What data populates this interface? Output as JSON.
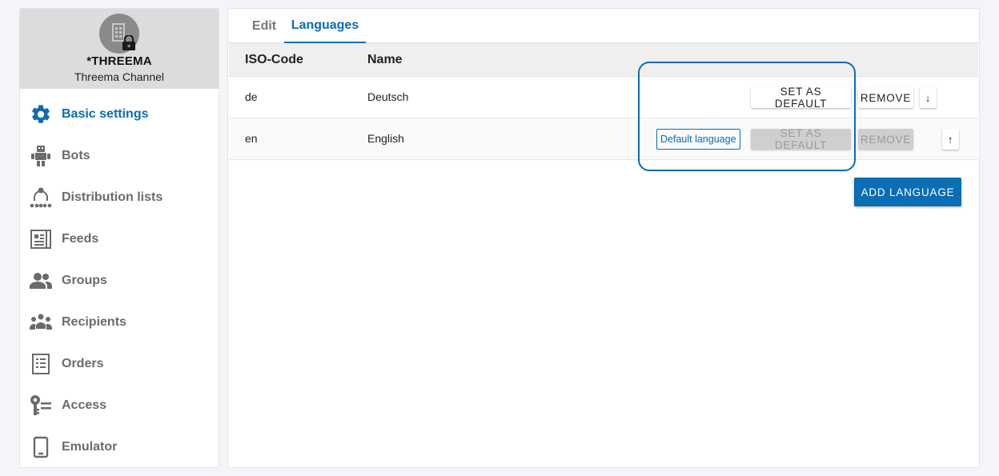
{
  "channel": {
    "name": "*THREEMA",
    "type": "Threema Channel"
  },
  "sidebar": {
    "items": [
      {
        "label": "Basic settings",
        "icon": "gear-icon",
        "active": true
      },
      {
        "label": "Bots",
        "icon": "robot-icon",
        "active": false
      },
      {
        "label": "Distribution lists",
        "icon": "distribution-icon",
        "active": false
      },
      {
        "label": "Feeds",
        "icon": "feed-icon",
        "active": false
      },
      {
        "label": "Groups",
        "icon": "groups-icon",
        "active": false
      },
      {
        "label": "Recipients",
        "icon": "recipients-icon",
        "active": false
      },
      {
        "label": "Orders",
        "icon": "orders-icon",
        "active": false
      },
      {
        "label": "Access",
        "icon": "key-icon",
        "active": false
      },
      {
        "label": "Emulator",
        "icon": "phone-icon",
        "active": false
      }
    ]
  },
  "tabs": [
    {
      "label": "Edit",
      "active": false
    },
    {
      "label": "Languages",
      "active": true
    }
  ],
  "table": {
    "headers": {
      "iso": "ISO-Code",
      "name": "Name"
    },
    "rows": [
      {
        "iso": "de",
        "name": "Deutsch",
        "is_default": false
      },
      {
        "iso": "en",
        "name": "English",
        "is_default": true
      }
    ]
  },
  "actions": {
    "set_default": "SET AS DEFAULT",
    "remove": "REMOVE",
    "default_badge": "Default language",
    "move_down": "↓",
    "move_up": "↑",
    "add_language": "ADD LANGUAGE"
  },
  "colors": {
    "accent": "#0b6db3",
    "muted_text": "#6b6b6b",
    "disabled_bg": "#cfcfcf"
  }
}
